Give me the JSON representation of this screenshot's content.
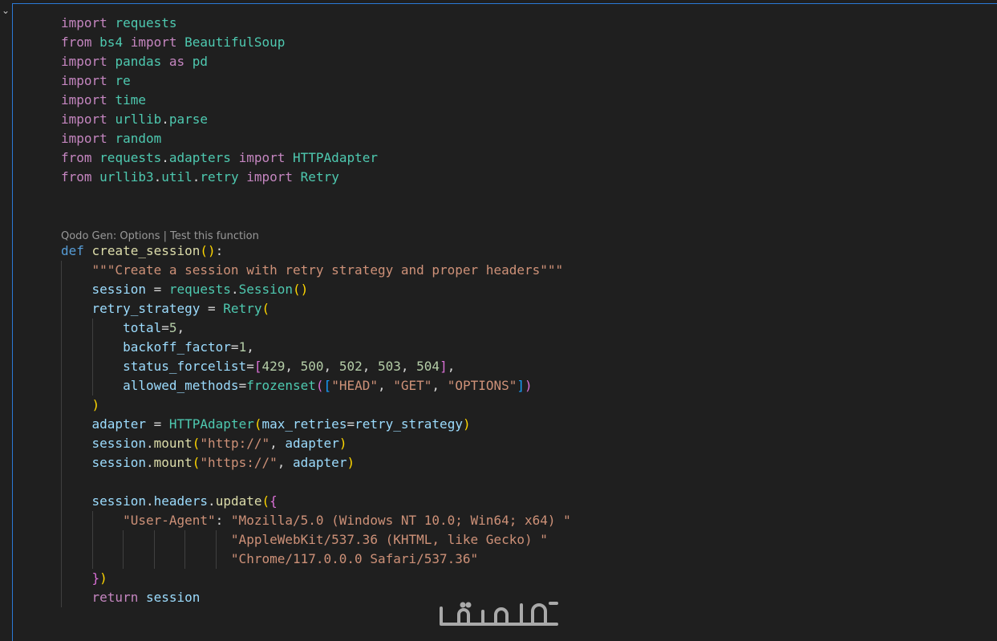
{
  "editor": {
    "codelens": {
      "options_label": "Qodo Gen: Options",
      "separator": " | ",
      "test_label": "Test this function"
    },
    "lines": [
      [
        [
          "kw",
          "import"
        ],
        [
          "pl",
          " "
        ],
        [
          "mod",
          "requests"
        ]
      ],
      [
        [
          "kw",
          "from"
        ],
        [
          "pl",
          " "
        ],
        [
          "mod",
          "bs4"
        ],
        [
          "pl",
          " "
        ],
        [
          "kw",
          "import"
        ],
        [
          "pl",
          " "
        ],
        [
          "mod",
          "BeautifulSoup"
        ]
      ],
      [
        [
          "kw",
          "import"
        ],
        [
          "pl",
          " "
        ],
        [
          "mod",
          "pandas"
        ],
        [
          "pl",
          " "
        ],
        [
          "kw",
          "as"
        ],
        [
          "pl",
          " "
        ],
        [
          "mod",
          "pd"
        ]
      ],
      [
        [
          "kw",
          "import"
        ],
        [
          "pl",
          " "
        ],
        [
          "mod",
          "re"
        ]
      ],
      [
        [
          "kw",
          "import"
        ],
        [
          "pl",
          " "
        ],
        [
          "mod",
          "time"
        ]
      ],
      [
        [
          "kw",
          "import"
        ],
        [
          "pl",
          " "
        ],
        [
          "mod",
          "urllib"
        ],
        [
          "pl",
          "."
        ],
        [
          "mod",
          "parse"
        ]
      ],
      [
        [
          "kw",
          "import"
        ],
        [
          "pl",
          " "
        ],
        [
          "mod",
          "random"
        ]
      ],
      [
        [
          "kw",
          "from"
        ],
        [
          "pl",
          " "
        ],
        [
          "mod",
          "requests"
        ],
        [
          "pl",
          "."
        ],
        [
          "mod",
          "adapters"
        ],
        [
          "pl",
          " "
        ],
        [
          "kw",
          "import"
        ],
        [
          "pl",
          " "
        ],
        [
          "mod",
          "HTTPAdapter"
        ]
      ],
      [
        [
          "kw",
          "from"
        ],
        [
          "pl",
          " "
        ],
        [
          "mod",
          "urllib3"
        ],
        [
          "pl",
          "."
        ],
        [
          "mod",
          "util"
        ],
        [
          "pl",
          "."
        ],
        [
          "mod",
          "retry"
        ],
        [
          "pl",
          " "
        ],
        [
          "kw",
          "import"
        ],
        [
          "pl",
          " "
        ],
        [
          "mod",
          "Retry"
        ]
      ],
      [],
      [],
      [
        [
          "kwb",
          "def"
        ],
        [
          "pl",
          " "
        ],
        [
          "fn",
          "create_session"
        ],
        [
          "b1",
          "()"
        ],
        [
          "pl",
          ":"
        ]
      ],
      [
        [
          "pl",
          "    "
        ],
        [
          "str",
          "\"\"\"Create a session with retry strategy and proper headers\"\"\""
        ]
      ],
      [
        [
          "pl",
          "    "
        ],
        [
          "var",
          "session"
        ],
        [
          "op",
          " = "
        ],
        [
          "mod",
          "requests"
        ],
        [
          "pl",
          "."
        ],
        [
          "mod",
          "Session"
        ],
        [
          "b1",
          "()"
        ]
      ],
      [
        [
          "pl",
          "    "
        ],
        [
          "var",
          "retry_strategy"
        ],
        [
          "op",
          " = "
        ],
        [
          "mod",
          "Retry"
        ],
        [
          "b1",
          "("
        ]
      ],
      [
        [
          "pl",
          "        "
        ],
        [
          "var",
          "total"
        ],
        [
          "op",
          "="
        ],
        [
          "num",
          "5"
        ],
        [
          "pl",
          ","
        ]
      ],
      [
        [
          "pl",
          "        "
        ],
        [
          "var",
          "backoff_factor"
        ],
        [
          "op",
          "="
        ],
        [
          "num",
          "1"
        ],
        [
          "pl",
          ","
        ]
      ],
      [
        [
          "pl",
          "        "
        ],
        [
          "var",
          "status_forcelist"
        ],
        [
          "op",
          "="
        ],
        [
          "b2",
          "["
        ],
        [
          "num",
          "429"
        ],
        [
          "pl",
          ", "
        ],
        [
          "num",
          "500"
        ],
        [
          "pl",
          ", "
        ],
        [
          "num",
          "502"
        ],
        [
          "pl",
          ", "
        ],
        [
          "num",
          "503"
        ],
        [
          "pl",
          ", "
        ],
        [
          "num",
          "504"
        ],
        [
          "b2",
          "]"
        ],
        [
          "pl",
          ","
        ]
      ],
      [
        [
          "pl",
          "        "
        ],
        [
          "var",
          "allowed_methods"
        ],
        [
          "op",
          "="
        ],
        [
          "mod",
          "frozenset"
        ],
        [
          "b2",
          "("
        ],
        [
          "b3",
          "["
        ],
        [
          "str",
          "\"HEAD\""
        ],
        [
          "pl",
          ", "
        ],
        [
          "str",
          "\"GET\""
        ],
        [
          "pl",
          ", "
        ],
        [
          "str",
          "\"OPTIONS\""
        ],
        [
          "b3",
          "]"
        ],
        [
          "b2",
          ")"
        ]
      ],
      [
        [
          "pl",
          "    "
        ],
        [
          "b1",
          ")"
        ]
      ],
      [
        [
          "pl",
          "    "
        ],
        [
          "var",
          "adapter"
        ],
        [
          "op",
          " = "
        ],
        [
          "mod",
          "HTTPAdapter"
        ],
        [
          "b1",
          "("
        ],
        [
          "var",
          "max_retries"
        ],
        [
          "op",
          "="
        ],
        [
          "var",
          "retry_strategy"
        ],
        [
          "b1",
          ")"
        ]
      ],
      [
        [
          "pl",
          "    "
        ],
        [
          "var",
          "session"
        ],
        [
          "pl",
          "."
        ],
        [
          "fn",
          "mount"
        ],
        [
          "b1",
          "("
        ],
        [
          "str",
          "\"http://\""
        ],
        [
          "pl",
          ", "
        ],
        [
          "var",
          "adapter"
        ],
        [
          "b1",
          ")"
        ]
      ],
      [
        [
          "pl",
          "    "
        ],
        [
          "var",
          "session"
        ],
        [
          "pl",
          "."
        ],
        [
          "fn",
          "mount"
        ],
        [
          "b1",
          "("
        ],
        [
          "str",
          "\"https://\""
        ],
        [
          "pl",
          ", "
        ],
        [
          "var",
          "adapter"
        ],
        [
          "b1",
          ")"
        ]
      ],
      [],
      [
        [
          "pl",
          "    "
        ],
        [
          "var",
          "session"
        ],
        [
          "pl",
          "."
        ],
        [
          "var",
          "headers"
        ],
        [
          "pl",
          "."
        ],
        [
          "fn",
          "update"
        ],
        [
          "b1",
          "("
        ],
        [
          "b2",
          "{"
        ]
      ],
      [
        [
          "pl",
          "        "
        ],
        [
          "str",
          "\"User-Agent\""
        ],
        [
          "pl",
          ": "
        ],
        [
          "str",
          "\"Mozilla/5.0 (Windows NT 10.0; Win64; x64) \""
        ]
      ],
      [
        [
          "pl",
          "                      "
        ],
        [
          "str",
          "\"AppleWebKit/537.36 (KHTML, like Gecko) \""
        ]
      ],
      [
        [
          "pl",
          "                      "
        ],
        [
          "str",
          "\"Chrome/117.0.0.0 Safari/537.36\""
        ]
      ],
      [
        [
          "pl",
          "    "
        ],
        [
          "b2",
          "}"
        ],
        [
          "b1",
          ")"
        ]
      ],
      [
        [
          "pl",
          "    "
        ],
        [
          "kw",
          "return"
        ],
        [
          "pl",
          " "
        ],
        [
          "var",
          "session"
        ]
      ]
    ]
  },
  "watermark": {
    "text": "خمسات",
    "color": "#a9a9a9"
  }
}
